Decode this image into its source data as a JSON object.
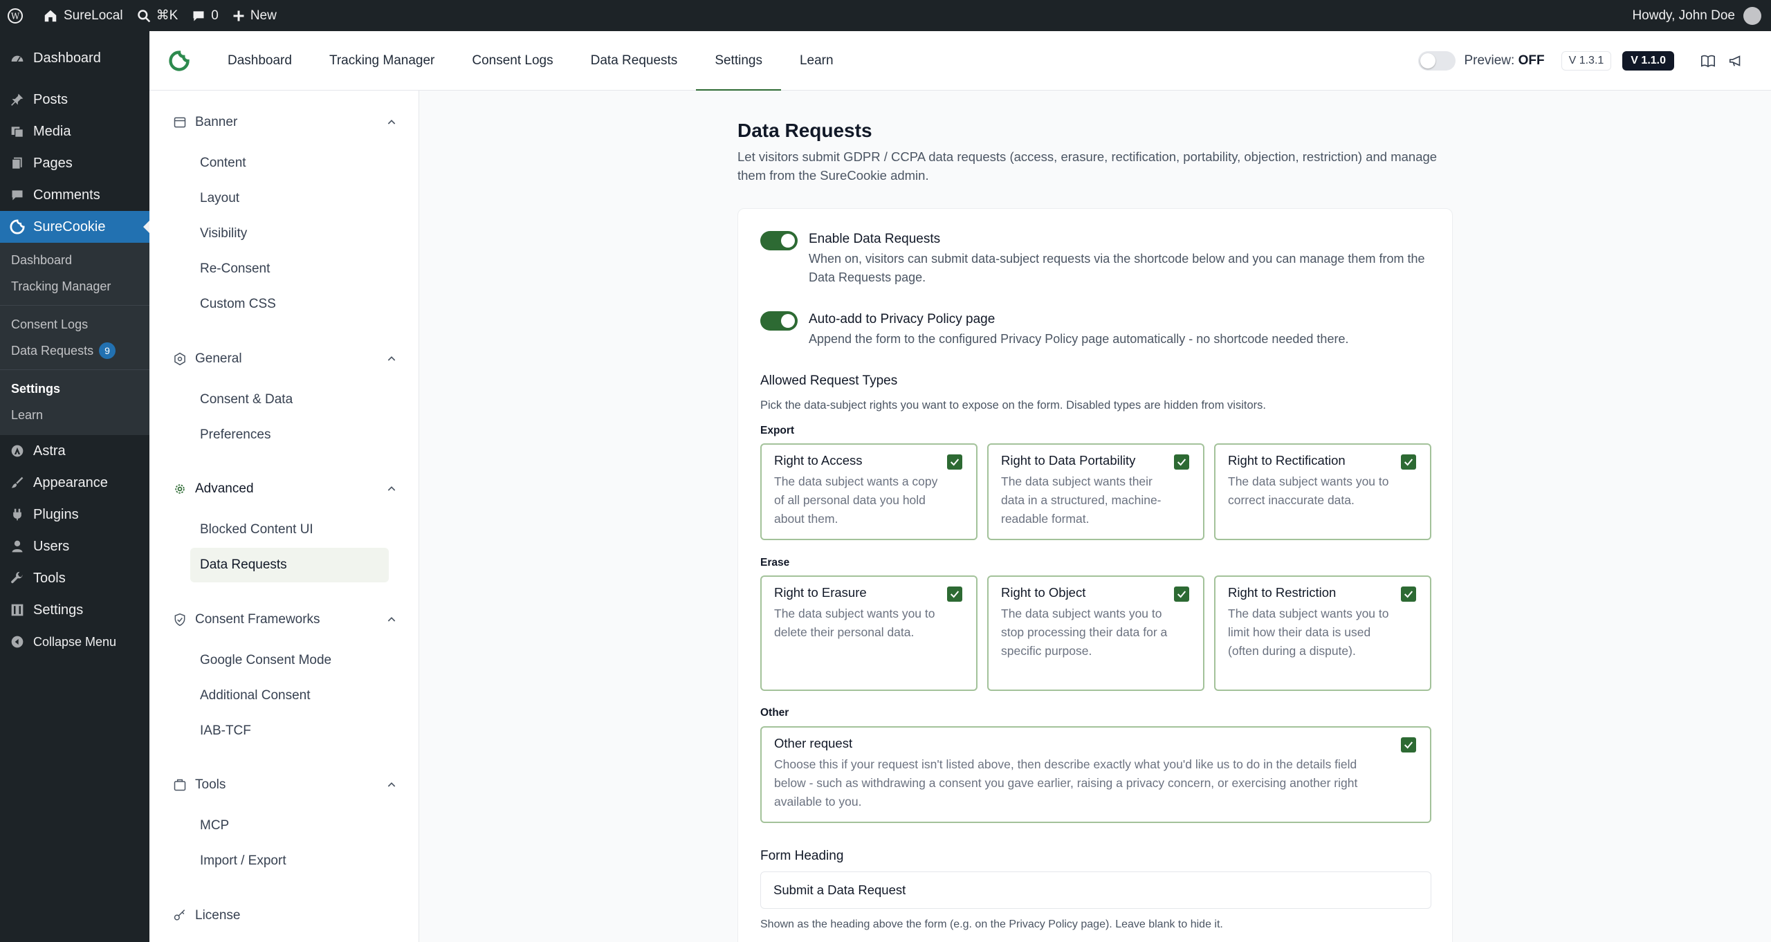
{
  "adminbar": {
    "site_name": "SureLocal",
    "search_shortcut": "⌘K",
    "comments_count": "0",
    "new_label": "New",
    "howdy": "Howdy, John Doe"
  },
  "wp_menu": {
    "dashboard": "Dashboard",
    "posts": "Posts",
    "media": "Media",
    "pages": "Pages",
    "comments": "Comments",
    "surecookie": "SureCookie",
    "sub": {
      "dashboard": "Dashboard",
      "tracking_manager": "Tracking Manager",
      "consent_logs": "Consent Logs",
      "data_requests": "Data Requests",
      "data_requests_badge": "9",
      "settings": "Settings",
      "learn": "Learn"
    },
    "astra": "Astra",
    "appearance": "Appearance",
    "plugins": "Plugins",
    "users": "Users",
    "tools": "Tools",
    "settings": "Settings",
    "collapse": "Collapse Menu"
  },
  "topnav": {
    "tabs": [
      "Dashboard",
      "Tracking Manager",
      "Consent Logs",
      "Data Requests",
      "Settings",
      "Learn"
    ],
    "active_tab": "Settings",
    "preview_label": "Preview:",
    "preview_state": "OFF",
    "version_light": "V 1.3.1",
    "version_dark": "V 1.1.0"
  },
  "settings_nav": {
    "banner": "Banner",
    "banner_items": [
      "Content",
      "Layout",
      "Visibility",
      "Re-Consent",
      "Custom CSS"
    ],
    "general": "General",
    "general_items": [
      "Consent & Data",
      "Preferences"
    ],
    "advanced": "Advanced",
    "advanced_items": [
      "Blocked Content UI",
      "Data Requests"
    ],
    "consent_frameworks": "Consent Frameworks",
    "consent_frameworks_items": [
      "Google Consent Mode",
      "Additional Consent",
      "IAB-TCF"
    ],
    "tools": "Tools",
    "tools_items": [
      "MCP",
      "Import / Export"
    ],
    "license": "License"
  },
  "main": {
    "title": "Data Requests",
    "description": "Let visitors submit GDPR / CCPA data requests (access, erasure, rectification, portability, objection, restriction) and manage them from the SureCookie admin.",
    "enable": {
      "title": "Enable Data Requests",
      "desc": "When on, visitors can submit data-subject requests via the shortcode below and you can manage them from the Data Requests page.",
      "on": true
    },
    "autoadd": {
      "title": "Auto-add to Privacy Policy page",
      "desc": "Append the form to the configured Privacy Policy page automatically - no shortcode needed there.",
      "on": true
    },
    "allowed_title": "Allowed Request Types",
    "allowed_sub": "Pick the data-subject rights you want to expose on the form. Disabled types are hidden from visitors.",
    "cat_export": "Export",
    "cat_erase": "Erase",
    "cat_other": "Other",
    "requests": {
      "access": {
        "title": "Right to Access",
        "desc": "The data subject wants a copy of all personal data you hold about them.",
        "checked": true
      },
      "portability": {
        "title": "Right to Data Portability",
        "desc": "The data subject wants their data in a structured, machine-readable format.",
        "checked": true
      },
      "rectification": {
        "title": "Right to Rectification",
        "desc": "The data subject wants you to correct inaccurate data.",
        "checked": true
      },
      "erasure": {
        "title": "Right to Erasure",
        "desc": "The data subject wants you to delete their personal data.",
        "checked": true
      },
      "object": {
        "title": "Right to Object",
        "desc": "The data subject wants you to stop processing their data for a specific purpose.",
        "checked": true
      },
      "restriction": {
        "title": "Right to Restriction",
        "desc": "The data subject wants you to limit how their data is used (often during a dispute).",
        "checked": true
      },
      "other": {
        "title": "Other request",
        "desc": "Choose this if your request isn't listed above, then describe exactly what you'd like us to do in the details field below - such as withdrawing a consent you gave earlier, raising a privacy concern, or exercising another right available to you.",
        "checked": true
      }
    },
    "form_heading_label": "Form Heading",
    "form_heading_value": "Submit a Data Request",
    "form_heading_help": "Shown as the heading above the form (e.g. on the Privacy Policy page). Leave blank to hide it."
  }
}
